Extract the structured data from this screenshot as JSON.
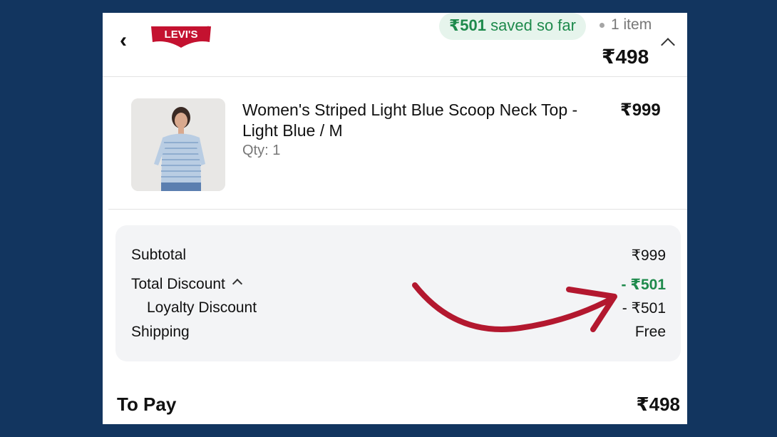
{
  "header": {
    "back_icon": "chevron-left-icon",
    "brand": "Levi's",
    "savings_amount": "₹501",
    "savings_text": "saved so far",
    "item_count": "1 item",
    "total": "₹498"
  },
  "product": {
    "name": "Women's Striped Light Blue Scoop Neck Top - Light Blue / M",
    "qty": "Qty: 1",
    "price": "₹999"
  },
  "summary": {
    "subtotal_label": "Subtotal",
    "subtotal_value": "₹999",
    "discount_label": "Total Discount",
    "discount_value": "- ₹501",
    "loyalty_label": "Loyalty Discount",
    "loyalty_value": "- ₹501",
    "shipping_label": "Shipping",
    "shipping_value": "Free"
  },
  "to_pay": {
    "label": "To Pay",
    "value": "₹498"
  },
  "colors": {
    "page_background": "#12355f",
    "savings_green": "#1e8a4c",
    "brand_red": "#c41230",
    "annotation_arrow": "#b3182f"
  }
}
